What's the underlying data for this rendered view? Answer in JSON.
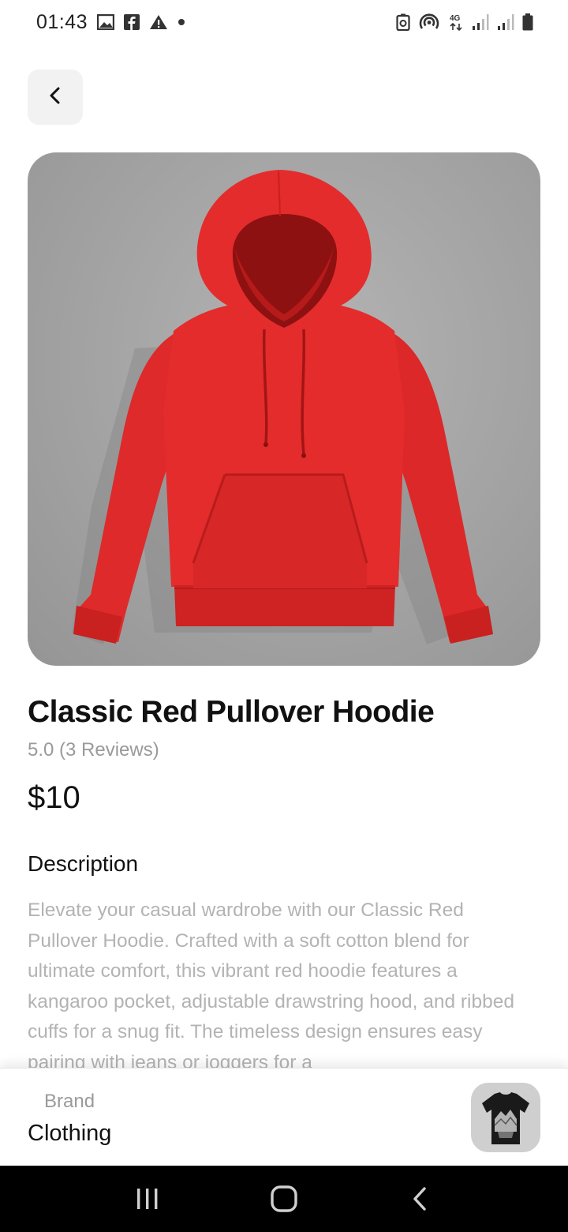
{
  "status_bar": {
    "time": "01:43",
    "left_icons": [
      "gallery-icon",
      "facebook-icon",
      "warning-icon",
      "dot-icon"
    ],
    "network_label": "4G",
    "right_icons": [
      "battery-saver-icon",
      "hotspot-icon",
      "network-4g-icon",
      "signal-icon",
      "signal-icon",
      "battery-icon"
    ]
  },
  "header": {
    "back_icon": "chevron-left-icon"
  },
  "product": {
    "image_icon": "red-hoodie-image",
    "title": "Classic Red Pullover Hoodie",
    "rating": "5.0 (3 Reviews)",
    "price": "$10",
    "description_heading": "Description",
    "description": "Elevate your casual wardrobe with our Classic Red Pullover Hoodie. Crafted with a soft cotton blend for ultimate comfort, this vibrant red hoodie features a kangaroo pocket, adjustable drawstring hood, and ribbed cuffs for a snug fit. The timeless design ensures easy pairing with jeans or joggers for a"
  },
  "brand": {
    "label": "Brand",
    "value": "Clothing",
    "thumbnail_icon": "black-tshirt-image"
  },
  "nav_bar": {
    "buttons": [
      "recent-apps-icon",
      "home-icon",
      "back-icon"
    ]
  },
  "colors": {
    "background": "#ffffff",
    "title": "#111111",
    "muted": "#9a9a9a",
    "description": "#b3b3b3",
    "hoodie_red": "#e62a2a",
    "image_bg": "#a3a3a3",
    "nav_bar": "#000000"
  }
}
